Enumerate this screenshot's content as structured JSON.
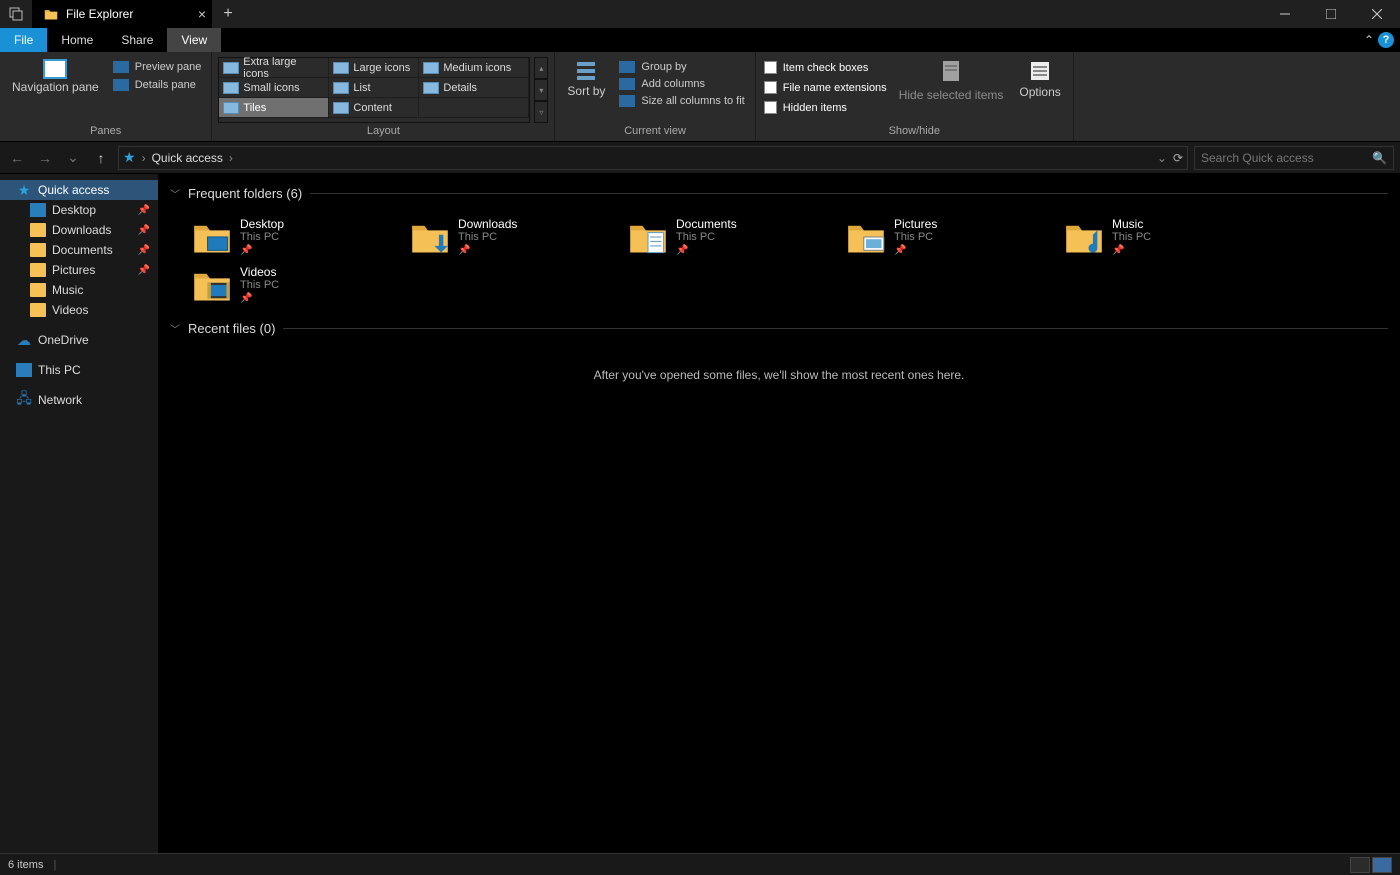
{
  "title": "File Explorer",
  "menubar": {
    "file": "File",
    "home": "Home",
    "share": "Share",
    "view": "View"
  },
  "ribbon": {
    "panes": {
      "nav": "Navigation pane",
      "preview": "Preview pane",
      "details": "Details pane",
      "group": "Panes"
    },
    "layout": {
      "xl": "Extra large icons",
      "large": "Large icons",
      "medium": "Medium icons",
      "small": "Small icons",
      "list": "List",
      "details": "Details",
      "tiles": "Tiles",
      "content": "Content",
      "group": "Layout"
    },
    "currentview": {
      "sortby": "Sort by",
      "groupby": "Group by",
      "addcols": "Add columns",
      "sizecols": "Size all columns to fit",
      "group": "Current view"
    },
    "showhide": {
      "itemcheck": "Item check boxes",
      "fileext": "File name extensions",
      "hidden": "Hidden items",
      "hidesel": "Hide selected items",
      "options": "Options",
      "group": "Show/hide"
    }
  },
  "address": {
    "location": "Quick access"
  },
  "search": {
    "placeholder": "Search Quick access"
  },
  "sidebar": {
    "quick": "Quick access",
    "desktop": "Desktop",
    "downloads": "Downloads",
    "documents": "Documents",
    "pictures": "Pictures",
    "music": "Music",
    "videos": "Videos",
    "onedrive": "OneDrive",
    "thispc": "This PC",
    "network": "Network"
  },
  "sections": {
    "frequent": "Frequent folders (6)",
    "recent": "Recent files (0)",
    "emptymsg": "After you've opened some files, we'll show the most recent ones here."
  },
  "folders": [
    {
      "name": "Desktop",
      "sub": "This PC",
      "kind": "desktop"
    },
    {
      "name": "Downloads",
      "sub": "This PC",
      "kind": "downloads"
    },
    {
      "name": "Documents",
      "sub": "This PC",
      "kind": "documents"
    },
    {
      "name": "Pictures",
      "sub": "This PC",
      "kind": "pictures"
    },
    {
      "name": "Music",
      "sub": "This PC",
      "kind": "music"
    },
    {
      "name": "Videos",
      "sub": "This PC",
      "kind": "videos"
    }
  ],
  "status": {
    "items": "6 items"
  }
}
